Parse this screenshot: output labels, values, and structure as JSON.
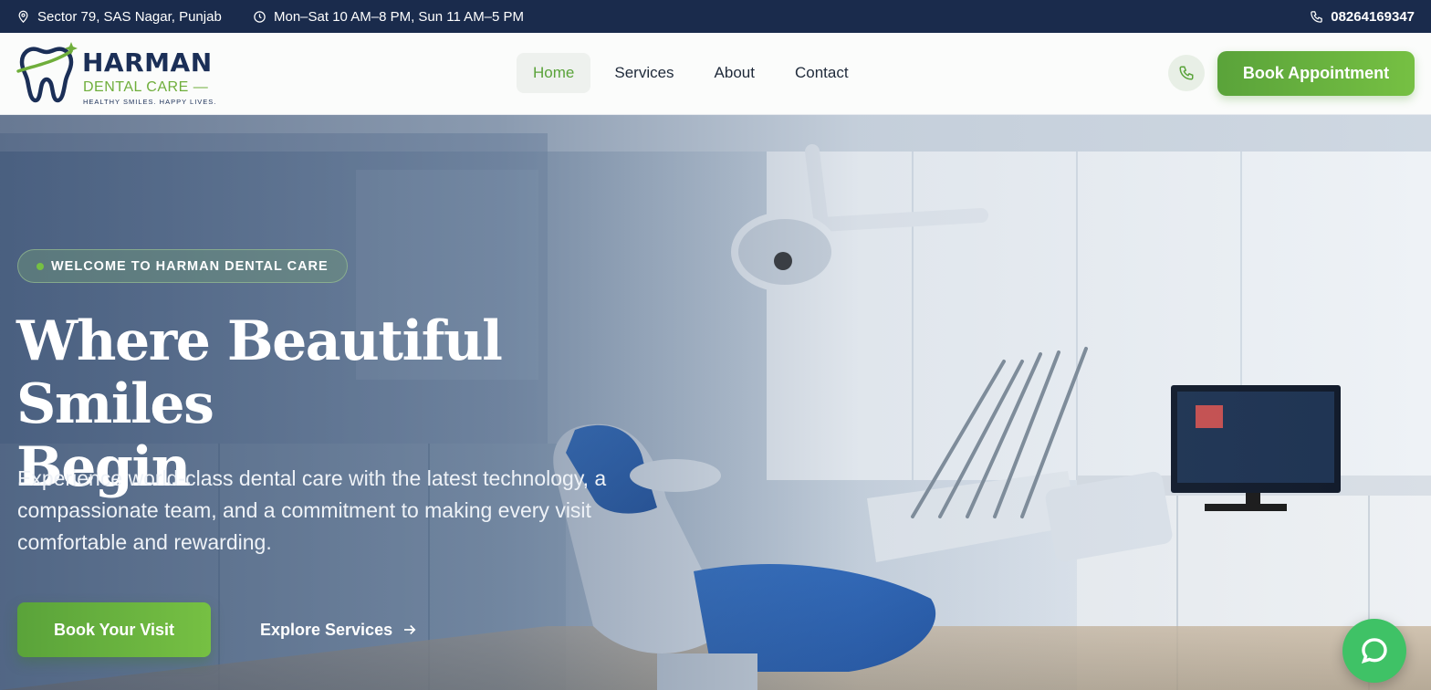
{
  "topbar": {
    "address": "Sector 79, SAS Nagar, Punjab",
    "hours": "Mon–Sat 10 AM–8 PM, Sun 11 AM–5 PM",
    "phone": "08264169347"
  },
  "logo": {
    "title": "HARMAN",
    "subtitle": "DENTAL CARE —",
    "tagline": "HEALTHY SMILES. HAPPY LIVES."
  },
  "nav": {
    "items": [
      {
        "label": "Home",
        "active": true
      },
      {
        "label": "Services",
        "active": false
      },
      {
        "label": "About",
        "active": false
      },
      {
        "label": "Contact",
        "active": false
      }
    ]
  },
  "header": {
    "cta_label": "Book Appointment"
  },
  "hero": {
    "badge": "WELCOME TO HARMAN DENTAL CARE",
    "title_line1": "Where Beautiful Smiles",
    "title_line2": "Begin",
    "description": "Experience world-class dental care with the latest technology, a compassionate team, and a commitment to making every visit comfortable and rewarding.",
    "primary_cta": "Book Your Visit",
    "secondary_cta": "Explore Services"
  },
  "colors": {
    "brand_navy": "#1b2f57",
    "brand_green": "#5aa33a",
    "topbar_bg": "#1a2b4c",
    "chat_green": "#3fc266"
  },
  "icons": {
    "address": "map-pin-icon",
    "hours": "clock-icon",
    "phone": "phone-icon",
    "chat": "chat-bubble-icon",
    "arrow": "arrow-right-icon"
  }
}
